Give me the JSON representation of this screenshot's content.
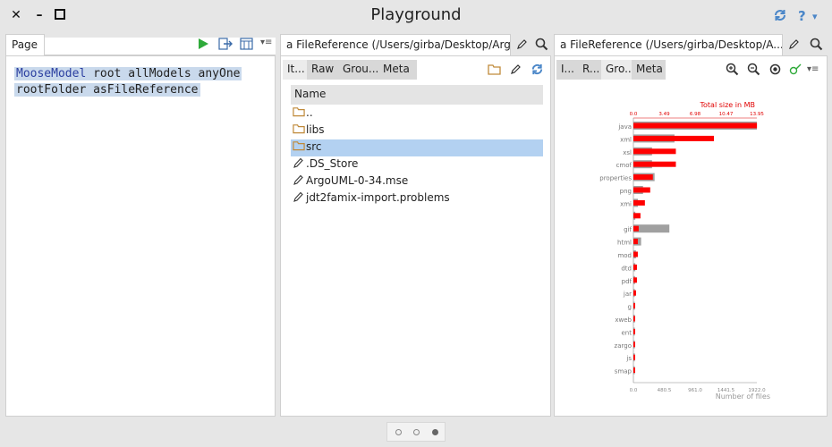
{
  "window": {
    "title": "Playground",
    "close_glyph": "✕",
    "minimize_glyph": "–",
    "maximize_glyph": "□",
    "help_glyph": "?",
    "menu_glyph": "▾"
  },
  "left_pane": {
    "tab_label": "Page",
    "code_lines": [
      {
        "kw": "MooseModel",
        "rest": " root allModels anyOne"
      },
      {
        "kw": "",
        "rest": "   rootFolder asFileReference"
      }
    ]
  },
  "middle_pane": {
    "tab_label": "a FileReference (/Users/girba/Desktop/ArgoU",
    "subtabs": [
      "It...",
      "Raw",
      "Grou...",
      "Meta"
    ],
    "column_header": "Name",
    "rows": [
      {
        "name": "..",
        "type": "folder"
      },
      {
        "name": "libs",
        "type": "folder"
      },
      {
        "name": "src",
        "type": "folder",
        "selected": true
      },
      {
        "name": ".DS_Store",
        "type": "file"
      },
      {
        "name": "ArgoUML-0-34.mse",
        "type": "file"
      },
      {
        "name": "jdt2famix-import.problems",
        "type": "file"
      }
    ]
  },
  "right_pane": {
    "tab_label": "a FileReference (/Users/girba/Desktop/A...",
    "subtabs": [
      "I...",
      "R...",
      "Gro...",
      "Meta"
    ]
  },
  "chart_data": {
    "type": "bar",
    "categories": [
      "java",
      "xml",
      "xsl",
      "cmof",
      "properties",
      "png",
      "xmi",
      "",
      "gif",
      "html",
      "mod",
      "dtd",
      "pdf",
      "jar",
      "g",
      "xweb",
      "ent",
      "zargo",
      "js",
      "smap"
    ],
    "series": [
      {
        "name": "Total size in MB",
        "values": [
          13.96,
          9.1,
          4.8,
          4.8,
          2.2,
          1.9,
          1.3,
          0.8,
          0.6,
          0.5,
          0.5,
          0.4,
          0.4,
          0.3,
          0.2,
          0.2,
          0.2,
          0.2,
          0.2,
          0.2
        ],
        "color": "#ff0000"
      },
      {
        "name": "Number of files",
        "values": [
          1922.6,
          640,
          290,
          290,
          330,
          150,
          70,
          30,
          560,
          120,
          40,
          30,
          25,
          20,
          15,
          10,
          10,
          10,
          8,
          8
        ],
        "color": "#a0a0a0"
      }
    ],
    "top_axis": {
      "label": "Total size in MB",
      "ticks": [
        "0.0",
        "3.49",
        "6.98",
        "10.47",
        "13.95"
      ],
      "max": 13.95
    },
    "bottom_axis": {
      "label": "Number of files",
      "ticks": [
        "0.0",
        "480.5",
        "961.0",
        "1441.5",
        "1922.0"
      ],
      "max": 1922.0
    }
  },
  "colors": {
    "accent_blue": "#4a86c8",
    "selection": "#b3d1f1",
    "folder": "#c08a3a",
    "play_green": "#2faa3a",
    "bar_red": "#ff0000",
    "bar_gray": "#a0a0a0"
  }
}
